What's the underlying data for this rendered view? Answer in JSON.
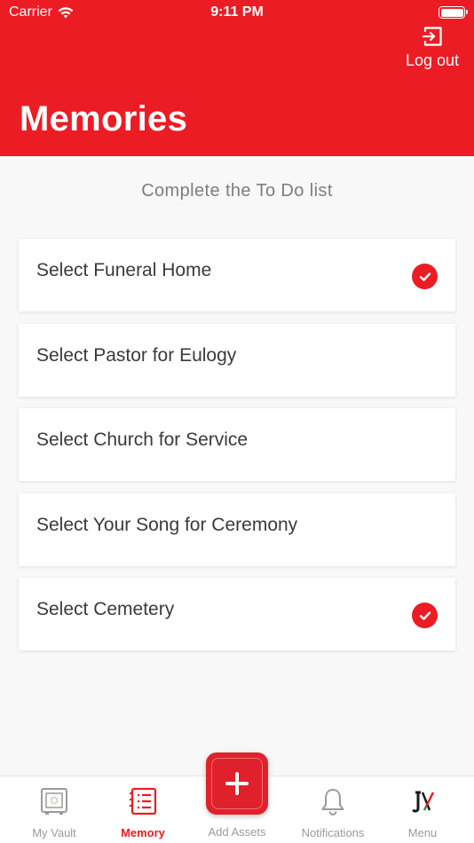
{
  "status_bar": {
    "carrier": "Carrier",
    "time": "9:11 PM"
  },
  "header": {
    "title": "Memories",
    "logout_label": "Log out",
    "background_color": "#ec1c24"
  },
  "subtitle": "Complete the To Do list",
  "todos": [
    {
      "label": "Select Funeral Home",
      "checked": true
    },
    {
      "label": "Select Pastor for Eulogy",
      "checked": false
    },
    {
      "label": "Select Church for Service",
      "checked": false
    },
    {
      "label": "Select Your Song for Ceremony",
      "checked": false
    },
    {
      "label": "Select Cemetery",
      "checked": true
    }
  ],
  "tabbar": {
    "tabs": [
      {
        "label": "My Vault",
        "icon": "vault-icon",
        "active": false
      },
      {
        "label": "Memory",
        "icon": "memory-list-icon",
        "active": true
      },
      {
        "label": "Add Assets",
        "icon": "plus-icon",
        "active": false
      },
      {
        "label": "Notifications",
        "icon": "bell-icon",
        "active": false
      },
      {
        "label": "Menu",
        "icon": "brand-logo-icon",
        "active": false
      }
    ],
    "active_color": "#ec1c24",
    "inactive_color": "#9a9a9a"
  }
}
